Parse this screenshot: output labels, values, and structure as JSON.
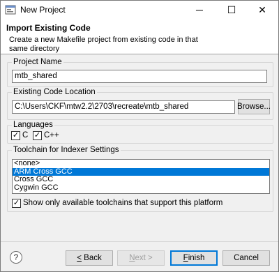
{
  "window": {
    "title": "New Project",
    "min_glyph": "─",
    "max_glyph": "☐",
    "close_glyph": "✕"
  },
  "header": {
    "title": "Import Existing Code",
    "description": "Create a new Makefile project from existing code in that same directory"
  },
  "project_name": {
    "label": "Project Name",
    "value": "mtb_shared"
  },
  "code_location": {
    "label": "Existing Code Location",
    "value": "C:\\Users\\CKF\\mtw2.2\\2703\\recreate\\mtb_shared",
    "browse_label": "Browse..."
  },
  "languages": {
    "label": "Languages",
    "items": [
      {
        "label": "C",
        "checked": true
      },
      {
        "label": "C++",
        "checked": true
      }
    ]
  },
  "toolchain": {
    "label": "Toolchain for Indexer Settings",
    "items": [
      "<none>",
      "ARM Cross GCC",
      "Cross GCC",
      "Cygwin GCC"
    ],
    "selected": "ARM Cross GCC",
    "filter_label": "Show only available toolchains that support this platform",
    "filter_checked": true
  },
  "footer": {
    "help_glyph": "?",
    "back_mnemonic": "<",
    "back_rest": " Back",
    "next_mnemonic": "N",
    "next_rest": "ext >",
    "finish_mnemonic": "F",
    "finish_rest": "inish",
    "cancel_label": "Cancel"
  },
  "colors": {
    "selection": "#0078d7",
    "check": "#000000"
  }
}
